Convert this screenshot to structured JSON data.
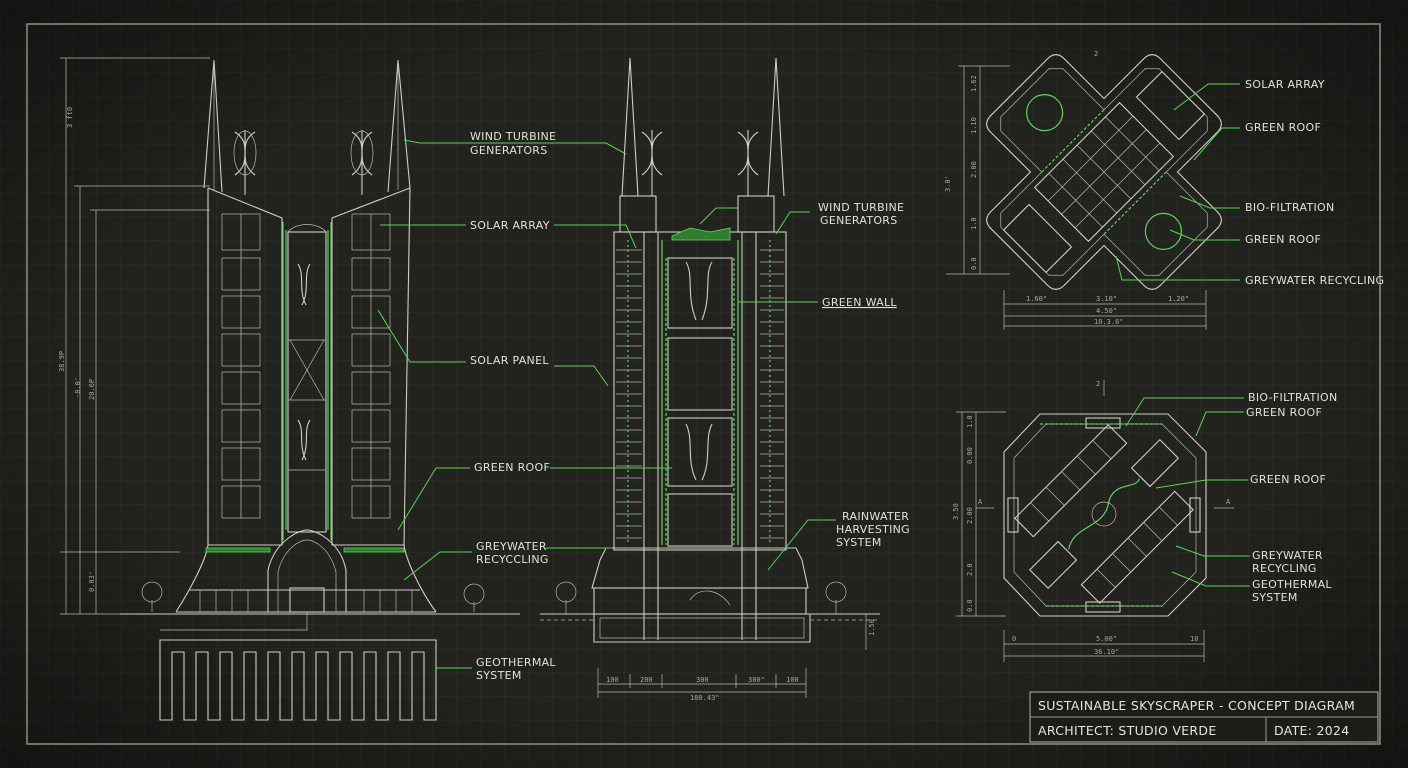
{
  "elevation_labels": {
    "wind_turbine": [
      "WIND TURBINE",
      "GENERATORS"
    ],
    "solar_array": "SOLAR ARRAY",
    "solar_panel": "SOLAR PANEL",
    "green_roof": "GREEN ROOF",
    "greywater": [
      "GREYWATER",
      "RECYCCLING"
    ],
    "geothermal": [
      "GEOTHERMAL",
      "SYSTEM"
    ]
  },
  "section_labels": {
    "wind_turbine": [
      "WIND TURBINE",
      "GENERATORS"
    ],
    "green_wall": "GREEN WALL",
    "rainwater": [
      "RAINWATER",
      "HARVESTING",
      "SYSTEM"
    ]
  },
  "plan_top_labels": {
    "solar_array": "SOLAR ARRAY",
    "green_roof_1": "GREEN ROOF",
    "bio_filtration": "BIO-FILTRATION",
    "green_roof_2": "GREEN ROOF",
    "greywater": "GREYWATER RECYCLING"
  },
  "plan_bottom_labels": {
    "bio_filtration": "BIO-FILTRATION",
    "green_roof_1": "GREEN ROOF",
    "green_roof_2": "GREEN ROOF",
    "greywater": [
      "GREYWATER",
      "RECYCLING"
    ],
    "geothermal": [
      "GEOTHERMAL",
      "SYSTEM"
    ]
  },
  "dimensions": {
    "elev_left": [
      "3 ft0",
      "-8.0'",
      "38.9P",
      "20.6P",
      "0.03'"
    ],
    "section_bottom": [
      "100",
      "200",
      "300",
      "300\"",
      "100",
      "180.43\""
    ],
    "section_right": "1.50",
    "plan_top_left": [
      "1.62",
      "1.10",
      "2.00",
      "3.0'",
      "1.0",
      "0.0"
    ],
    "plan_top_bottom": [
      "1.60\"",
      "3.10\"",
      "1.20\"",
      "4.50\"",
      "10.3.6\""
    ],
    "plan_bottom_left": [
      "1.0",
      "0.00",
      "2.00",
      "3.50",
      "2.0",
      "0.0"
    ],
    "plan_bottom_bottom": [
      "0",
      "5.00\"",
      "10",
      "36.10\""
    ],
    "plan_top_number": "2",
    "plan_bottom_number": "2",
    "section_marker": "A"
  },
  "title_block": {
    "title": "SUSTAINABLE SKYSCRAPER - CONCEPT DIAGRAM",
    "architect": "ARCHITECT: STUDIO VERDE",
    "date": "DATE: 2024"
  }
}
